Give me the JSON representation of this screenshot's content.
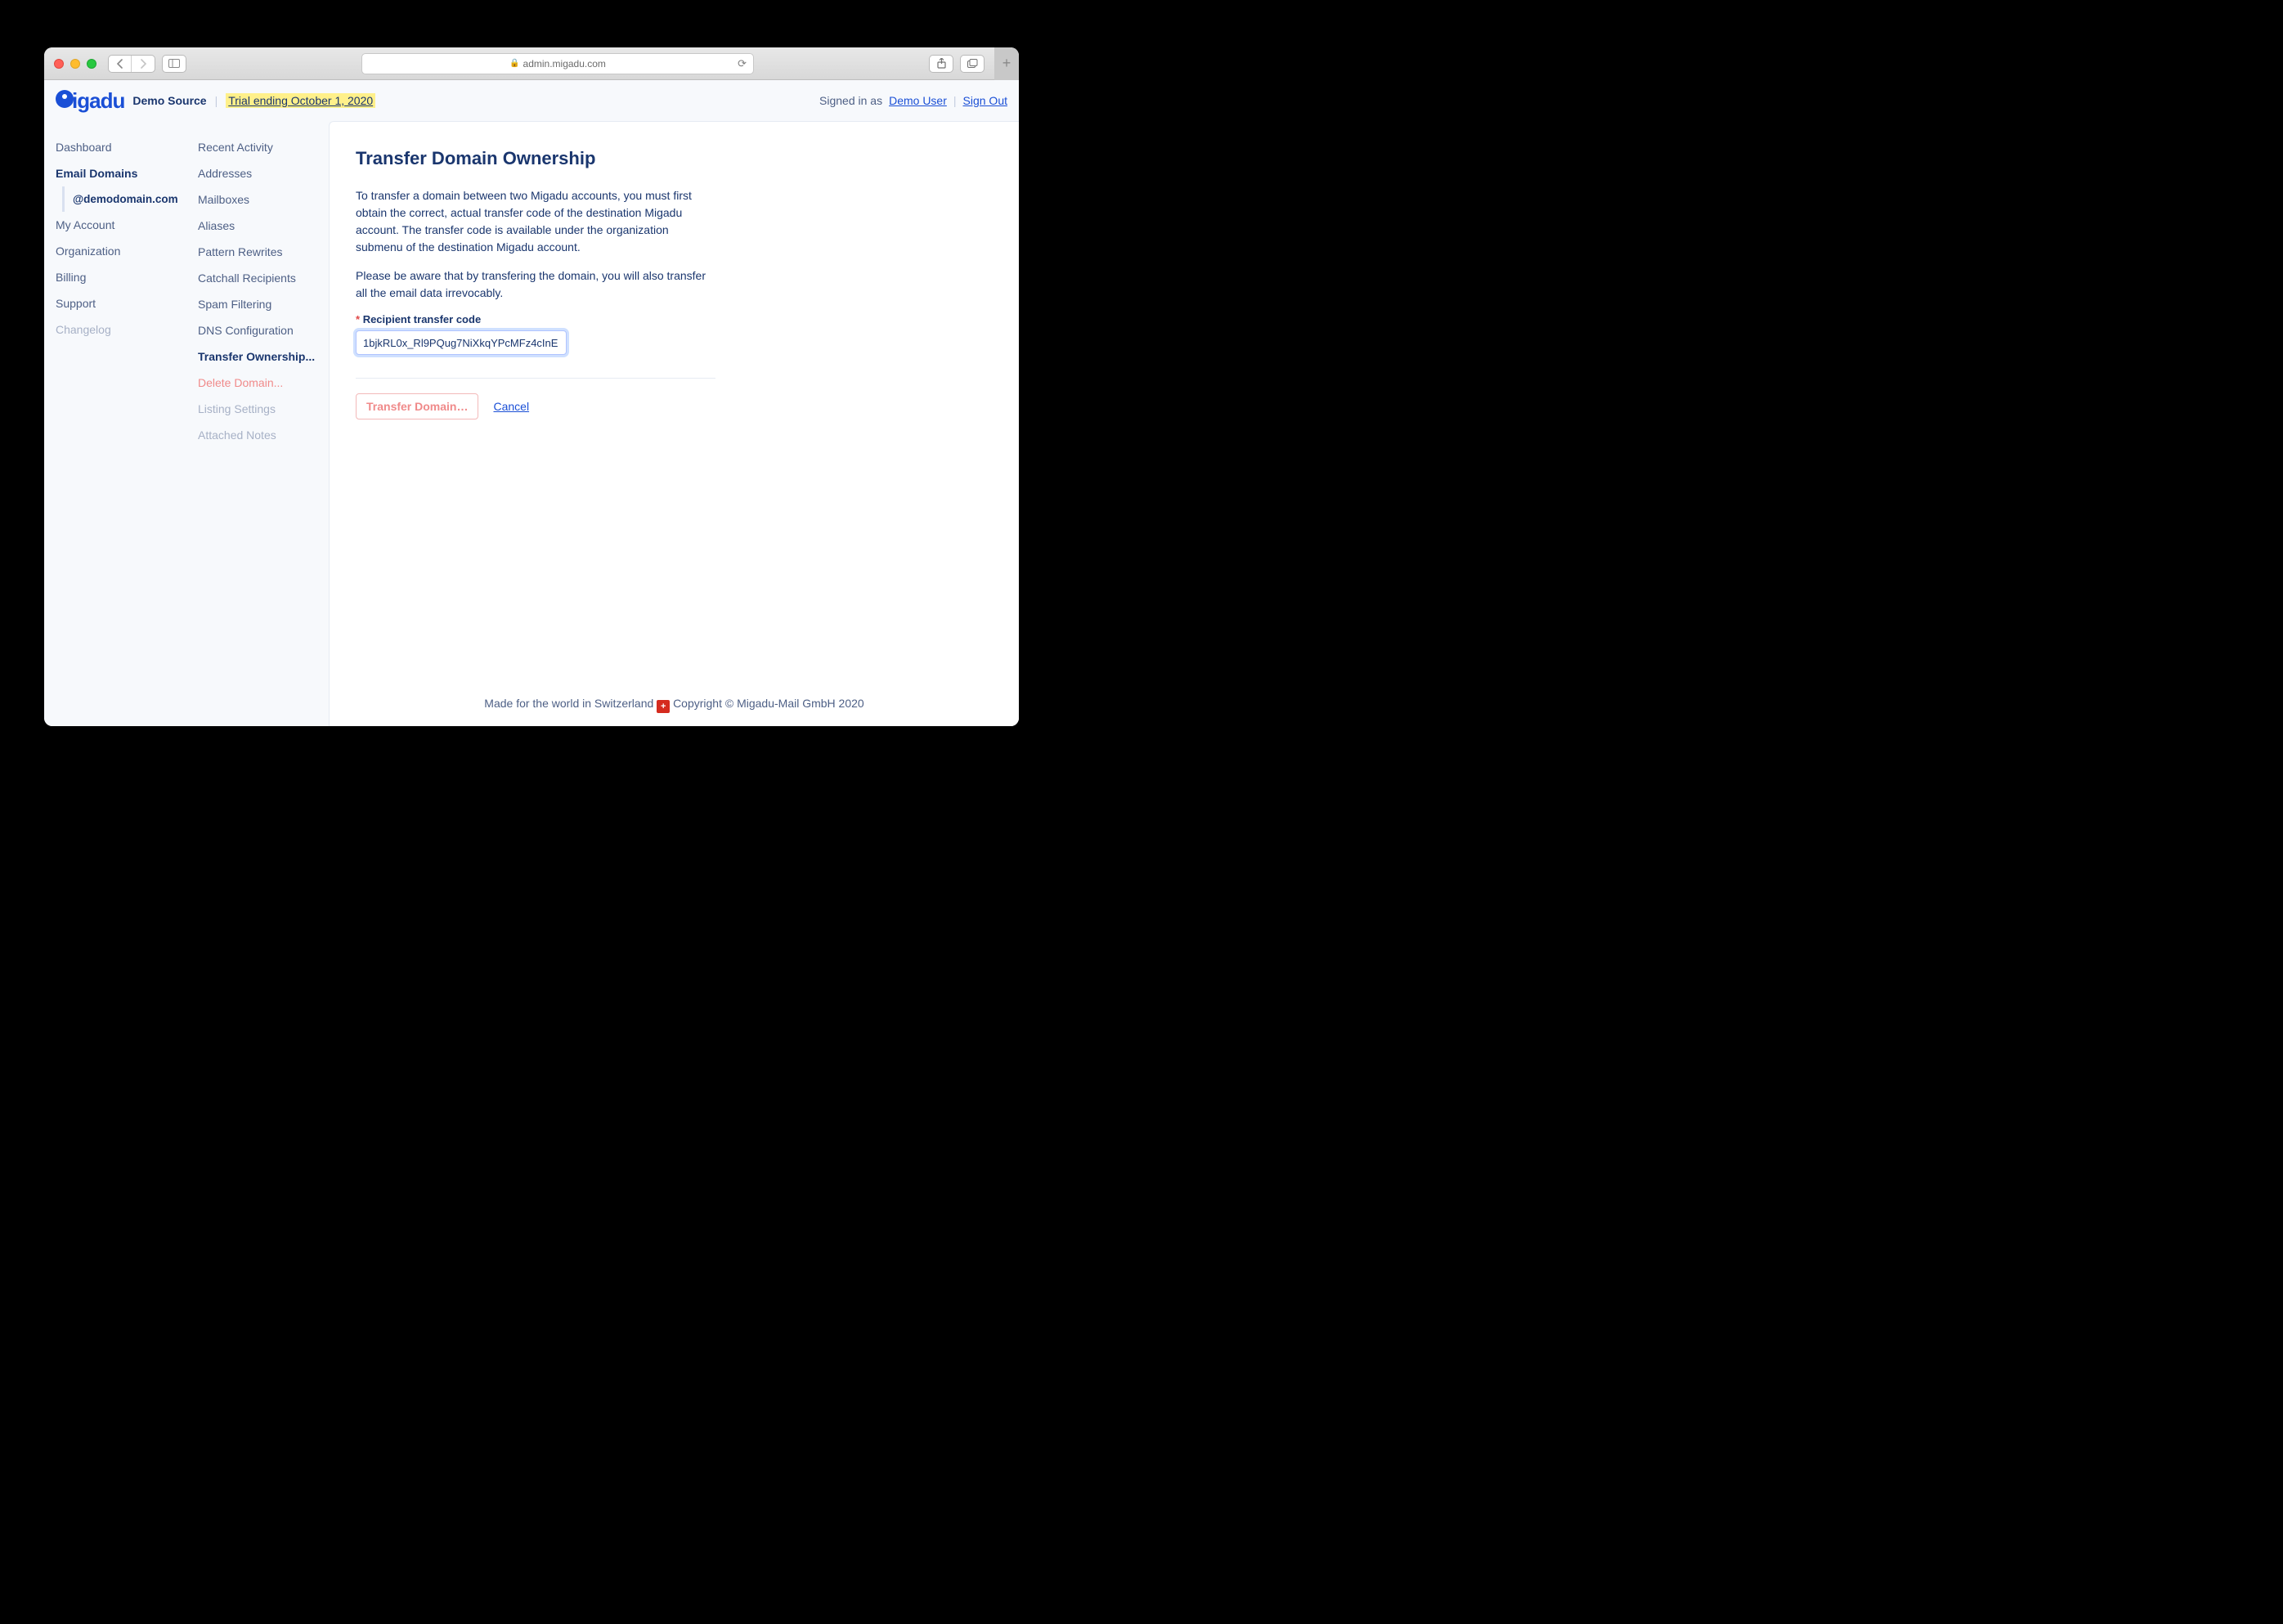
{
  "browser": {
    "url": "admin.migadu.com"
  },
  "header": {
    "logo_text": "igadu",
    "org": "Demo Source",
    "trial": "Trial ending October 1, 2020",
    "signed_in_prefix": "Signed in as",
    "user": "Demo User",
    "signout": "Sign Out"
  },
  "nav1": {
    "dashboard": "Dashboard",
    "email_domains": "Email Domains",
    "domain": "@demodomain.com",
    "my_account": "My Account",
    "organization": "Organization",
    "billing": "Billing",
    "support": "Support",
    "changelog": "Changelog"
  },
  "nav2": {
    "recent": "Recent Activity",
    "addresses": "Addresses",
    "mailboxes": "Mailboxes",
    "aliases": "Aliases",
    "pattern": "Pattern Rewrites",
    "catchall": "Catchall Recipients",
    "spam": "Spam Filtering",
    "dns": "DNS Configuration",
    "transfer": "Transfer Ownership...",
    "delete": "Delete Domain...",
    "listing": "Listing Settings",
    "notes": "Attached Notes"
  },
  "main": {
    "title": "Transfer Domain Ownership",
    "p1": "To transfer a domain between two Migadu accounts, you must first obtain the correct, actual transfer code of the destination Migadu account. The transfer code is available under the organization submenu of the destination Migadu account.",
    "p2": "Please be aware that by transfering the domain, you will also transfer all the email data irrevocably.",
    "label": "Recipient transfer code",
    "code_value": "1bjkRL0x_Rl9PQug7NiXkqYPcMFz4cInE",
    "transfer_btn": "Transfer Domain…",
    "cancel": "Cancel"
  },
  "footer": {
    "left": "Made for the world in Switzerland",
    "right": "Copyright © Migadu-Mail GmbH 2020"
  }
}
